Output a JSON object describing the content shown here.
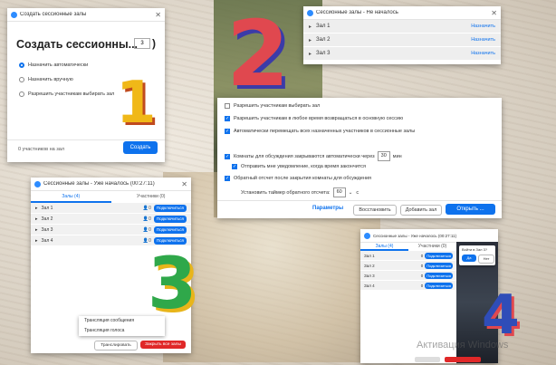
{
  "panel1": {
    "window_title": "Создать сессионные залы",
    "heading": "Создать сессионны...",
    "room_count_value": "3",
    "paren": ")",
    "options": [
      {
        "label": "Назначить автоматически",
        "selected": true
      },
      {
        "label": "Назначить вручную",
        "selected": false
      },
      {
        "label": "Разрешить участникам выбирать зал",
        "selected": false
      }
    ],
    "participants_info": "0 участников на зал",
    "create_button": "Создать",
    "step_number": "1"
  },
  "panel2": {
    "window_title": "Сессионные залы - Не началось",
    "rooms": [
      {
        "name": "Зал 1",
        "action": "Назначить"
      },
      {
        "name": "Зал 2",
        "action": "Назначить"
      },
      {
        "name": "Зал 3",
        "action": "Назначить"
      }
    ],
    "options": [
      {
        "label": "Разрешить участникам выбирать зал",
        "checked": false
      },
      {
        "label": "Разрешить участникам в любое время возвращаться в основную сессию",
        "checked": true
      },
      {
        "label": "Автоматически перемещать всех назначенных участников в сессионные залы",
        "checked": true
      },
      {
        "label": "Комнаты для обсуждения закрываются автоматически через",
        "checked": true,
        "value": "30",
        "unit": "мин"
      },
      {
        "label": "Отправить мне уведомление, когда время закончится",
        "checked": true
      },
      {
        "label": "Обратный отсчет после закрытия комнаты для обсуждения",
        "checked": true
      }
    ],
    "timer_label": "Установить таймер обратного отсчета:",
    "timer_value": "60",
    "timer_unit": "с",
    "params_link": "Параметры",
    "restore_button": "Восстановить",
    "add_room_button": "Добавить зал",
    "open_all_button": "Открыть ...",
    "step_number": "2"
  },
  "panel3": {
    "window_title": "Сессионные залы - Уже началось (00:27:11)",
    "tabs": [
      "Залы (4)",
      "Участники (0)"
    ],
    "rooms": [
      {
        "name": "Зал 1",
        "count": "0",
        "join": "Подключиться"
      },
      {
        "name": "Зал 2",
        "count": "0",
        "join": "Подключиться"
      },
      {
        "name": "Зал 3",
        "count": "0",
        "join": "Подключиться"
      },
      {
        "name": "Зал 4",
        "count": "0",
        "join": "Подключиться"
      }
    ],
    "menu_items": [
      "Трансляция сообщения",
      "Трансляция голоса"
    ],
    "broadcast_button": "Транслировать",
    "close_all_button": "Закрыть все залы",
    "step_number": "3"
  },
  "panel4": {
    "window_title": "Сессионные залы - Уже началось (00:27:11)",
    "tabs": [
      "Залы (4)",
      "Участники (0)"
    ],
    "rooms": [
      {
        "name": "Зал 1",
        "count": "0",
        "join": "Подключиться"
      },
      {
        "name": "Зал 2",
        "count": "0",
        "join": "Подключиться"
      },
      {
        "name": "Зал 3",
        "count": "0",
        "join": "Подключиться"
      },
      {
        "name": "Зал 4",
        "count": "0",
        "join": "Подключиться"
      }
    ],
    "popup_question": "Войти в Зал 3?",
    "popup_yes": "Да",
    "popup_no": "Нет",
    "step_number": "4"
  },
  "watermark": "Активация Windows",
  "colors": {
    "accent": "#0e72ed",
    "danger": "#e02828",
    "num1": "#f0b818",
    "num2": "#e0484f",
    "num3": "#2fa84a",
    "num4": "#2f4db8"
  }
}
